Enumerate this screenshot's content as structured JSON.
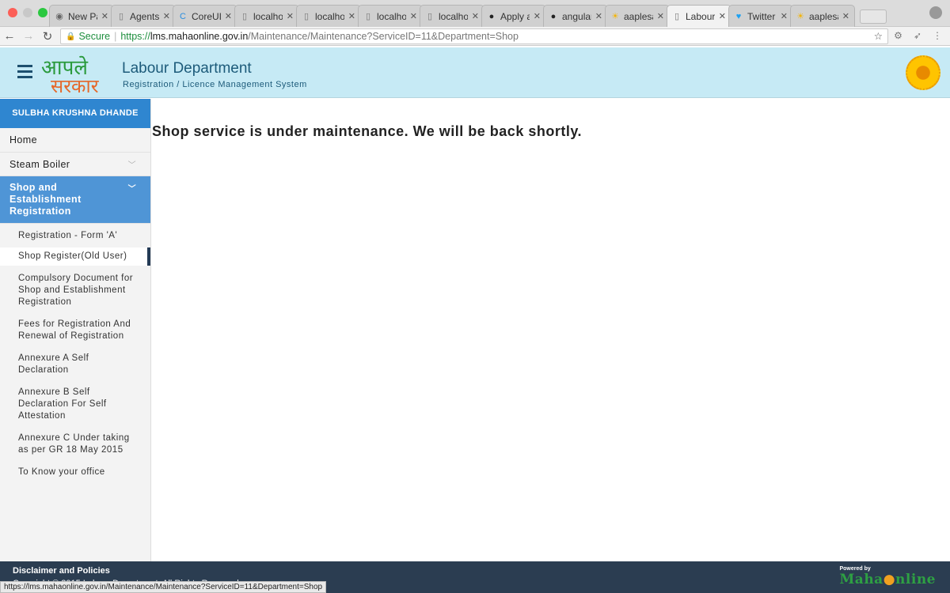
{
  "browser": {
    "tabs": [
      {
        "label": "New Pa",
        "icon": "eye-icon"
      },
      {
        "label": "Agents",
        "icon": "page-icon"
      },
      {
        "label": "CoreUI",
        "icon": "coreui-icon"
      },
      {
        "label": "localhos",
        "icon": "page-icon"
      },
      {
        "label": "localhos",
        "icon": "page-icon"
      },
      {
        "label": "localhos",
        "icon": "page-icon"
      },
      {
        "label": "localhos",
        "icon": "page-icon"
      },
      {
        "label": "Apply a",
        "icon": "github-icon"
      },
      {
        "label": "angular-",
        "icon": "github-icon"
      },
      {
        "label": "aaplesa",
        "icon": "sun-icon"
      },
      {
        "label": "Labour",
        "icon": "page-icon",
        "active": true
      },
      {
        "label": "Twitter",
        "icon": "twitter-icon"
      },
      {
        "label": "aaplesa",
        "icon": "sun-icon"
      }
    ],
    "secure_label": "Secure",
    "url_scheme": "https://",
    "url_host": "lms.mahaonline.gov.in",
    "url_path": "/Maintenance/Maintenance?ServiceID=11&Department=Shop",
    "status_url": "https://lms.mahaonline.gov.in/Maintenance/Maintenance?ServiceID=11&Department=Shop"
  },
  "header": {
    "logo_line1": "आपले",
    "logo_line2": "सरकार",
    "title": "Labour Department",
    "subtitle": "Registration / Licence Management System"
  },
  "sidebar": {
    "user": "SULBHA KRUSHNA DHANDE",
    "items": [
      {
        "label": "Home"
      },
      {
        "label": "Steam Boiler"
      },
      {
        "label": "Shop and Establishment Registration"
      }
    ],
    "subitems": [
      "Registration - Form 'A'",
      "Shop Register(Old User)",
      "Compulsory Document for Shop and Establishment Registration",
      "Fees for Registration And Renewal of Registration",
      "Annexure A Self Declaration",
      "Annexure B Self Declaration For Self Attestation",
      "Annexure C Under taking as per GR 18 May 2015",
      "To Know your office"
    ]
  },
  "main": {
    "message": "Shop service is under maintenance. We will be back shortly."
  },
  "footer": {
    "disclaimer": "Disclaimer and Policies",
    "copyright": "Copyright © 2015 Labour Department. All Rights Reserved",
    "powered_by": "Powered by",
    "brand_a": "Maha",
    "brand_b": "nline"
  },
  "colors": {
    "header_bg": "#c6eaf5",
    "accent": "#2f86d0",
    "footer_bg": "#2b3d51"
  }
}
